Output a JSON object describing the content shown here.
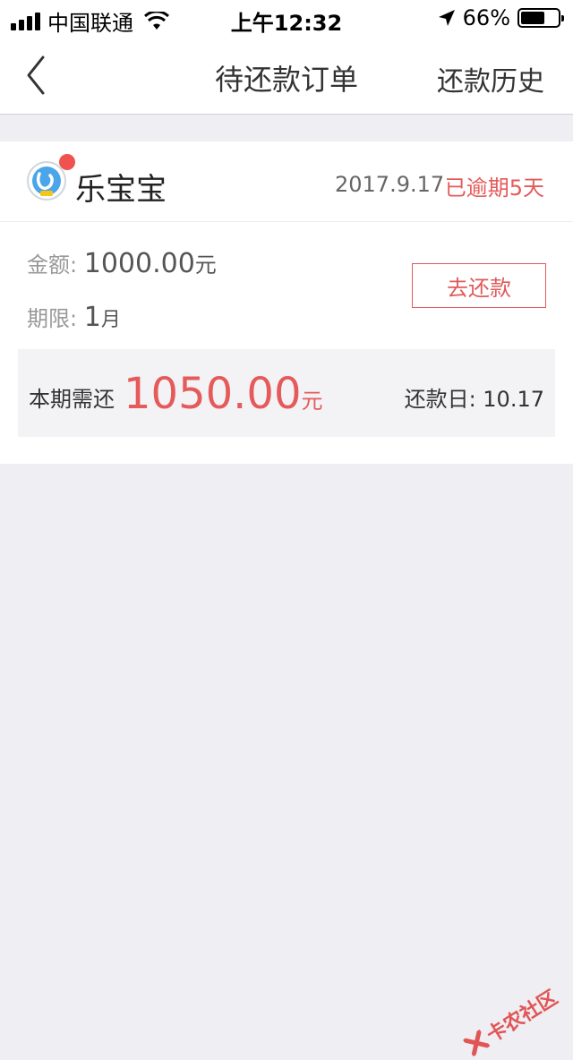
{
  "status_bar": {
    "carrier": "中国联通",
    "time": "上午12:32",
    "battery": "66%",
    "battery_level": 0.66
  },
  "nav": {
    "title": "待还款订单",
    "right_link": "还款历史"
  },
  "order": {
    "brand": "乐宝宝",
    "date": "2017.9.17",
    "status": "已逾期5天",
    "amount_label": "金额:",
    "amount_value": "1000.00",
    "amount_unit": "元",
    "term_label": "期限:",
    "term_value": "1",
    "term_unit": "月",
    "repay_button": "去还款",
    "due_label": "本期需还",
    "due_amount": "1050.00",
    "due_unit": "元",
    "due_date": "还款日: 10.17"
  },
  "watermark": "卡农社区",
  "colors": {
    "accent": "#e55a5a",
    "background": "#eeeef3"
  }
}
